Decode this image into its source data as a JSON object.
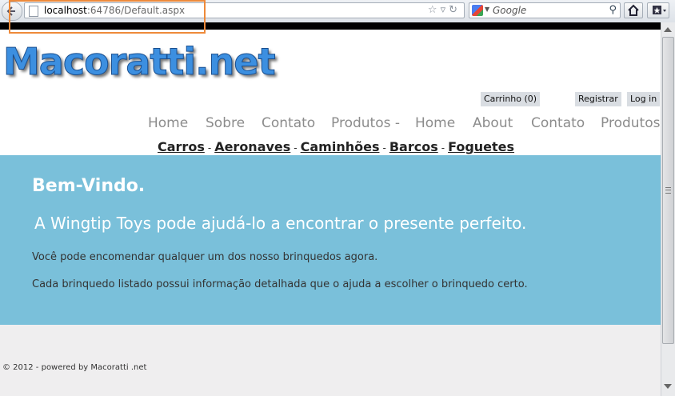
{
  "browser": {
    "url_host": "localhost",
    "url_rest": ":64786/Default.aspx",
    "search_placeholder": "Google"
  },
  "logo_text": "Macoratti.net",
  "account": {
    "cart": "Carrinho (0)",
    "register": "Registrar",
    "login": "Log in"
  },
  "main_nav": [
    "Home",
    "Sobre",
    "Contato",
    "Produtos -",
    "Home",
    "About",
    "Contato",
    "Produtos"
  ],
  "categories": [
    "Carros",
    "Aeronaves",
    "Caminhões",
    "Barcos",
    "Foguetes"
  ],
  "category_separator": "-",
  "hero": {
    "title": "Bem-Vindo.",
    "subtitle": "A Wingtip Toys pode ajudá-lo a encontrar o presente perfeito.",
    "line1": "Você pode encomendar qualquer um dos nosso brinquedos agora.",
    "line2": "Cada brinquedo listado possui informação detalhada que o ajuda a escolher o brinquedo certo."
  },
  "footer": "© 2012 - powered by Macoratti .net",
  "colors": {
    "hero_bg": "#7ac0da",
    "highlight": "#ee8a3a"
  }
}
